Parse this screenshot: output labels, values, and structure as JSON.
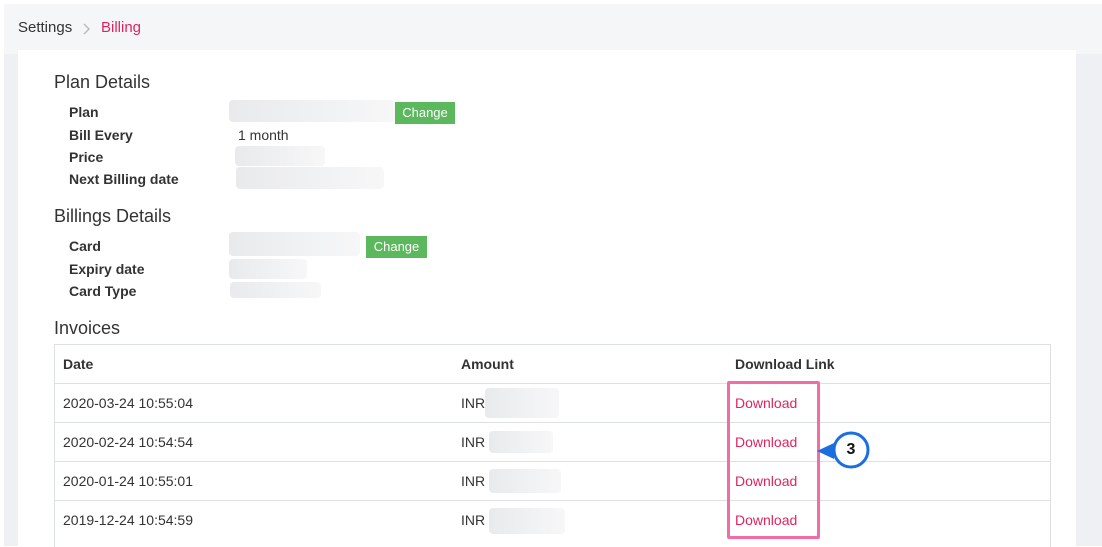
{
  "breadcrumb": {
    "parent": "Settings",
    "current": "Billing"
  },
  "plan_details": {
    "title": "Plan Details",
    "plan_label": "Plan",
    "bill_every_label": "Bill Every",
    "bill_every_value": "1 month",
    "price_label": "Price",
    "next_billing_label": "Next Billing date",
    "change_label": "Change"
  },
  "billing_details": {
    "title": "Billings Details",
    "card_label": "Card",
    "expiry_label": "Expiry date",
    "card_type_label": "Card Type",
    "change_label": "Change"
  },
  "invoices": {
    "title": "Invoices",
    "columns": [
      "Date",
      "Amount",
      "Download Link"
    ],
    "rows": [
      {
        "date": "2020-03-24 10:55:04",
        "currency": "INR",
        "link": "Download"
      },
      {
        "date": "2020-02-24 10:54:54",
        "currency": "INR",
        "link": "Download"
      },
      {
        "date": "2020-01-24 10:55:01",
        "currency": "INR",
        "link": "Download"
      },
      {
        "date": "2019-12-24 10:54:59",
        "currency": "INR",
        "link": "Download"
      }
    ]
  },
  "annotation": {
    "step_number": "3"
  },
  "colors": {
    "accent": "#e0245e",
    "button": "#5cb85c",
    "highlight": "#f26da5",
    "callout": "#1a6fe0"
  }
}
